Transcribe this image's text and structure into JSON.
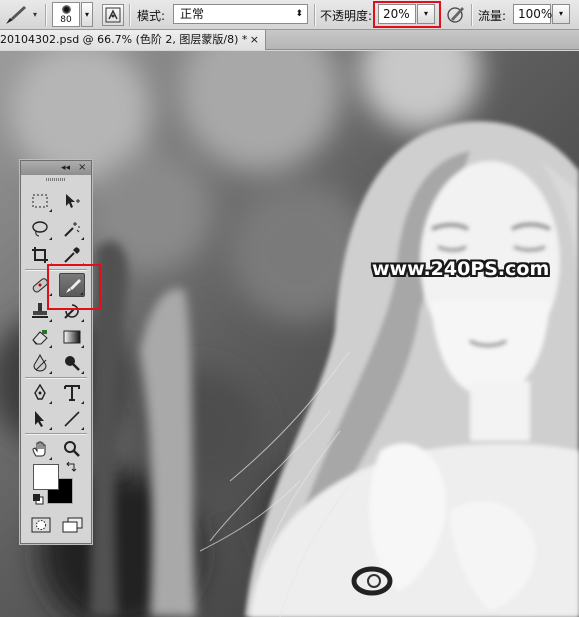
{
  "options_bar": {
    "brush_size": "80",
    "mode_label": "模式:",
    "mode_value": "正常",
    "opacity_label": "不透明度:",
    "opacity_value": "20%",
    "flow_label": "流量:",
    "flow_value": "100%"
  },
  "document": {
    "tab_title": "20104302.psd @ 66.7% (色阶 2, 图层蒙版/8) *",
    "tab_close": "×"
  },
  "tools": {
    "header_collapse": "◂◂",
    "header_close": "×",
    "items": [
      {
        "name": "rectangular-marquee-tool"
      },
      {
        "name": "move-tool"
      },
      {
        "name": "lasso-tool"
      },
      {
        "name": "magic-wand-tool"
      },
      {
        "name": "crop-tool"
      },
      {
        "name": "eyedropper-tool"
      },
      {
        "name": "spot-healing-brush-tool"
      },
      {
        "name": "brush-tool",
        "active": true
      },
      {
        "name": "clone-stamp-tool"
      },
      {
        "name": "history-brush-tool"
      },
      {
        "name": "eraser-tool"
      },
      {
        "name": "gradient-tool"
      },
      {
        "name": "blur-tool"
      },
      {
        "name": "dodge-tool"
      },
      {
        "name": "pen-tool"
      },
      {
        "name": "type-tool"
      },
      {
        "name": "path-selection-tool"
      },
      {
        "name": "line-tool"
      },
      {
        "name": "hand-tool"
      },
      {
        "name": "zoom-tool"
      }
    ],
    "foreground_color": "#ffffff",
    "background_color": "#000000"
  },
  "canvas": {
    "watermark": "www.240PS.com"
  },
  "colors": {
    "highlight_box": "#e0101a"
  }
}
